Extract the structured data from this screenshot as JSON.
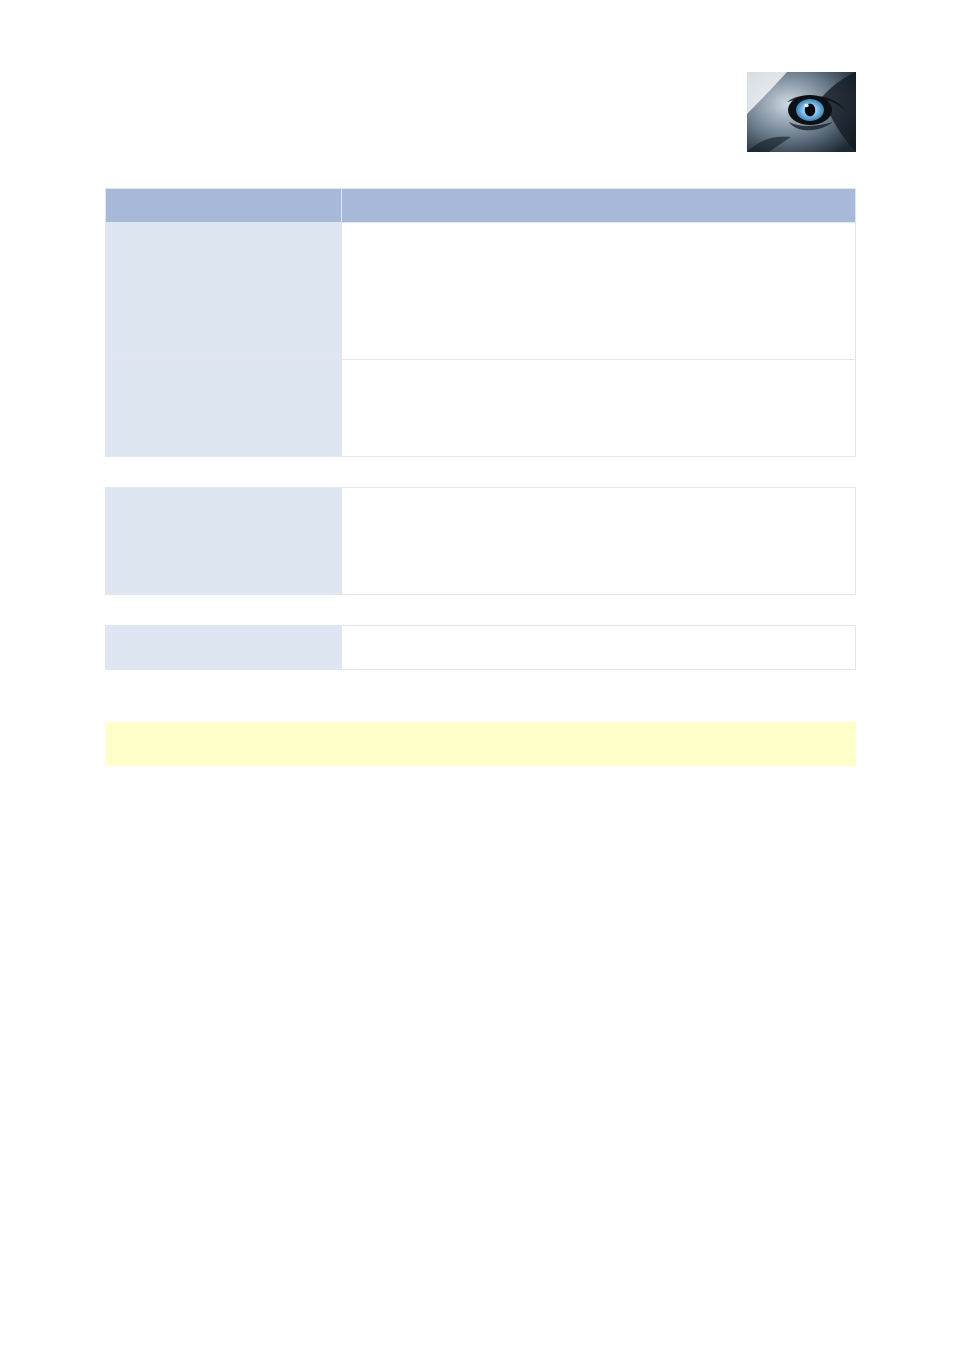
{
  "logo": {
    "name": "wolf-eye-logo"
  },
  "table1": {
    "header": {
      "label": "",
      "value": ""
    },
    "rows": [
      {
        "label": "",
        "value": ""
      },
      {
        "label": "",
        "value": ""
      }
    ]
  },
  "table2": {
    "rows": [
      {
        "label": "",
        "value": ""
      }
    ]
  },
  "table3": {
    "rows": [
      {
        "label": "",
        "value": ""
      }
    ]
  },
  "section": {
    "heading": "",
    "paragraphs": [
      "",
      ""
    ]
  },
  "note": {
    "text": ""
  },
  "footer": {
    "left": "",
    "right": ""
  }
}
